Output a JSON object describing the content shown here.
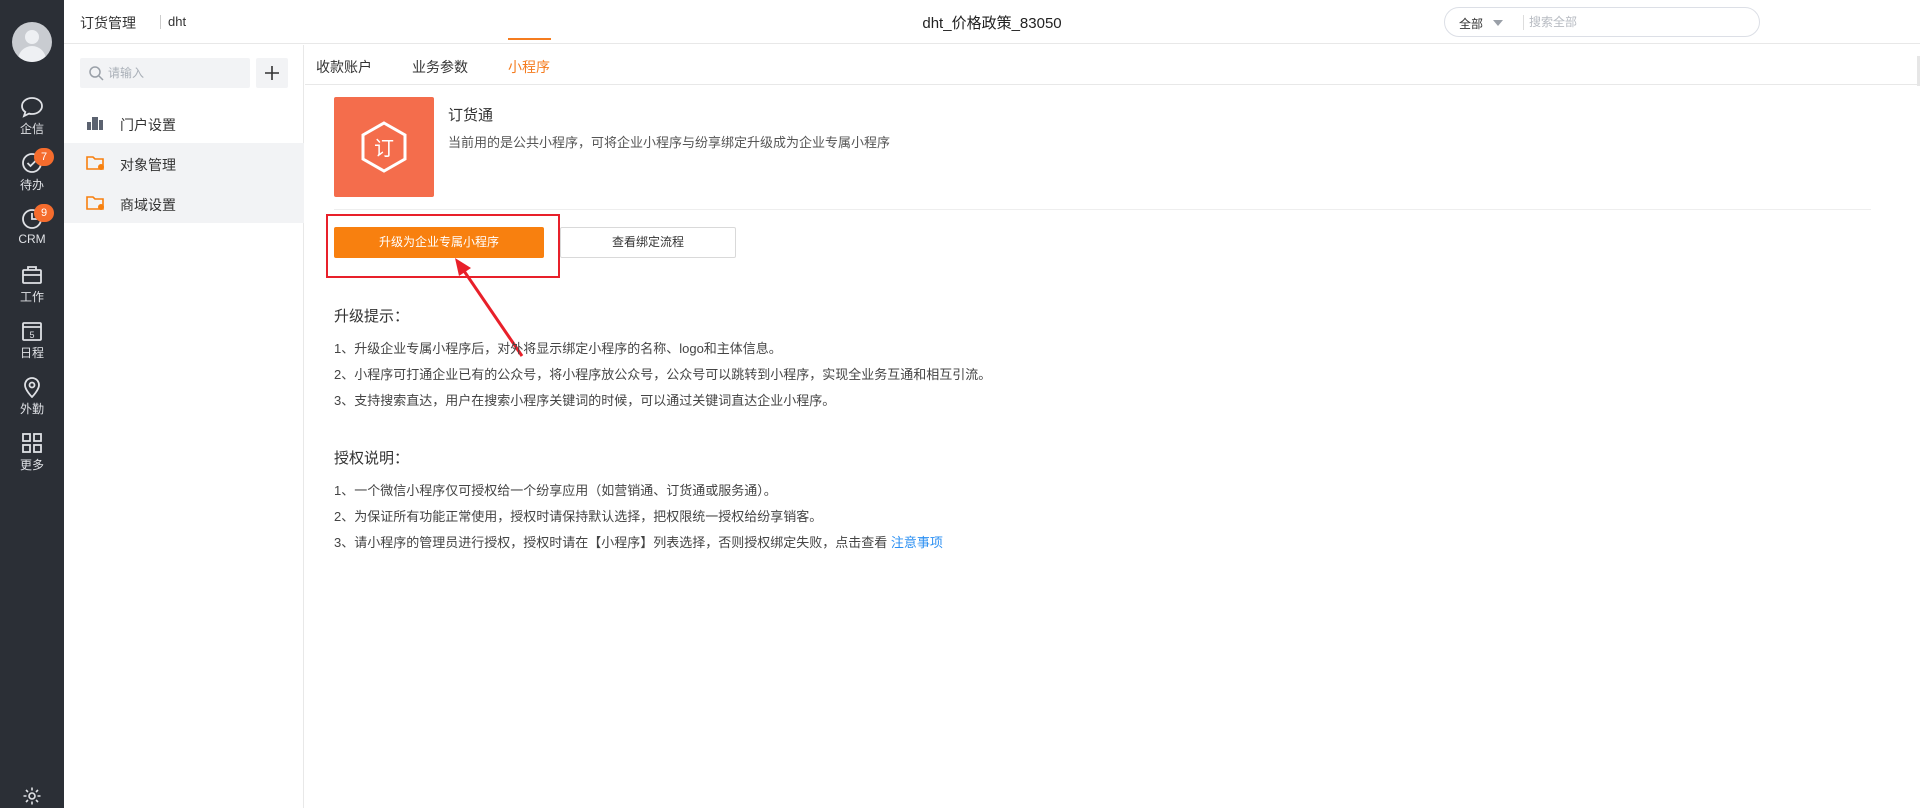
{
  "header": {
    "app_title": "订货管理",
    "app_sub": "dht",
    "page_title": "dht_价格政策_83050",
    "search": {
      "scope": "全部",
      "placeholder": "搜索全部"
    }
  },
  "rail": {
    "items": [
      {
        "label": "企信",
        "icon": "chat-icon"
      },
      {
        "label": "待办",
        "icon": "check-circle-icon",
        "badge": "7"
      },
      {
        "label": "CRM",
        "icon": "clock-icon",
        "badge": "9"
      },
      {
        "label": "工作",
        "icon": "briefcase-icon"
      },
      {
        "label": "日程",
        "icon": "calendar-icon",
        "day": "5"
      },
      {
        "label": "外勤",
        "icon": "location-pin-icon"
      },
      {
        "label": "更多",
        "icon": "grid-icon"
      }
    ]
  },
  "sidenav": {
    "filter_placeholder": "请输入",
    "items": [
      {
        "label": "门户设置",
        "icon": "building-icon"
      },
      {
        "label": "对象管理",
        "icon": "folder-gear-icon"
      },
      {
        "label": "商域设置",
        "icon": "folder-gear-icon"
      }
    ]
  },
  "tabs": [
    {
      "label": "收款账户"
    },
    {
      "label": "业务参数"
    },
    {
      "label": "小程序",
      "active": true
    }
  ],
  "miniprogram": {
    "logo_char": "订",
    "name": "订货通",
    "description": "当前用的是公共小程序，可将企业小程序与纷享绑定升级成为企业专属小程序",
    "upgrade_button": "升级为企业专属小程序",
    "flow_button": "查看绑定流程"
  },
  "upgrade_tips": {
    "title": "升级提示：",
    "lines": [
      "1、升级企业专属小程序后，对外将显示绑定小程序的名称、logo和主体信息。",
      "2、小程序可打通企业已有的公众号，将小程序放公众号，公众号可以跳转到小程序，实现全业务互通和相互引流。",
      "3、支持搜索直达，用户在搜索小程序关键词的时候，可以通过关键词直达企业小程序。"
    ]
  },
  "auth_notes": {
    "title": "授权说明：",
    "lines": [
      "1、一个微信小程序仅可授权给一个纷享应用（如营销通、订货通或服务通）。",
      "2、为保证所有功能正常使用，授权时请保持默认选择，把权限统一授权给纷享销客。",
      "3、请小程序的管理员进行授权，授权时请在【小程序】列表选择，否则授权绑定失败，点击查看 "
    ],
    "link": "注意事项"
  },
  "colors": {
    "accent": "#f8800f",
    "rail_bg": "#2b2f36",
    "logo_bg": "#f46d4c",
    "annotation": "#e8202a",
    "link": "#2b8ff2"
  }
}
